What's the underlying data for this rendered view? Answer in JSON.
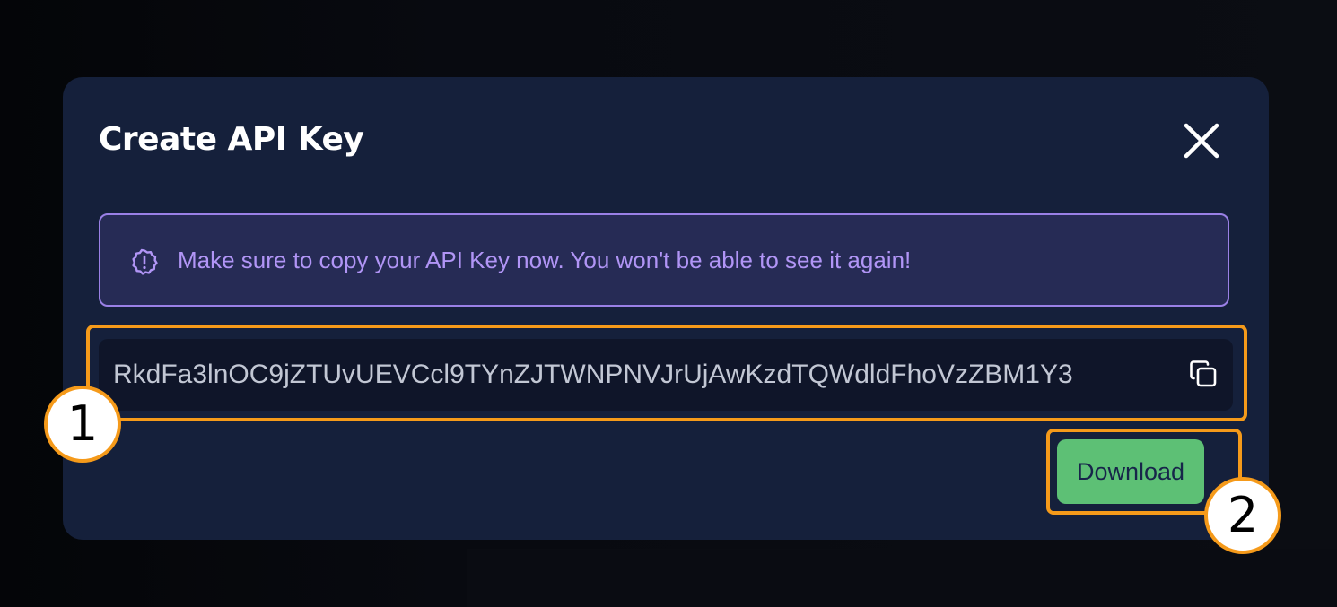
{
  "modal": {
    "title": "Create API Key",
    "close_icon": "close-icon",
    "warning": {
      "icon": "alert-badge-icon",
      "text": "Make sure to copy your API Key now. You won't be able to see it again!"
    },
    "api_key": {
      "value": "RkdFa3lnOC9jZTUvUEVCcl9TYnZJTWNPNVJrUjAwKzdTQWdldFhoVzZBM1Y3",
      "copy_icon": "copy-icon"
    },
    "download_label": "Download"
  },
  "annotations": [
    {
      "label": "1"
    },
    {
      "label": "2"
    }
  ],
  "colors": {
    "modal_bg": "#15203b",
    "warning_border": "#9a80e6",
    "warning_text": "#b195f6",
    "download_bg": "#5dc075",
    "highlight": "#f59a1a"
  }
}
